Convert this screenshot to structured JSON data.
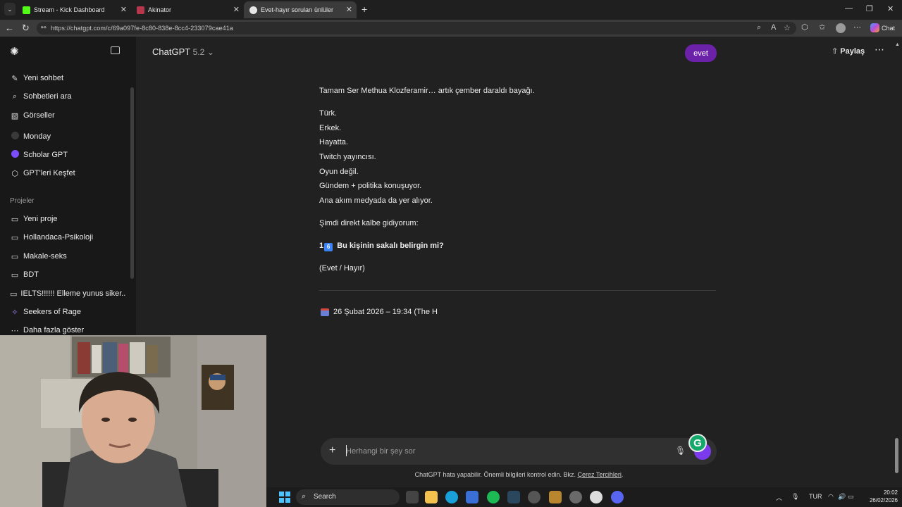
{
  "browser": {
    "tabs": [
      {
        "title": "Stream - Kick Dashboard",
        "active": false
      },
      {
        "title": "Akinator",
        "active": false
      },
      {
        "title": "Evet-hayır soruları ünlüler",
        "active": true
      }
    ],
    "url": "https://chatgpt.com/c/69a097fe-8c80-838e-8cc4-233079cae41a",
    "profile_label": "Chat"
  },
  "sidebar": {
    "top_items": [
      {
        "label": "Yeni sohbet",
        "icon": "edit-icon"
      },
      {
        "label": "Sohbetleri ara",
        "icon": "search-icon"
      },
      {
        "label": "Görseller",
        "icon": "image-icon"
      },
      {
        "label": "Monday",
        "icon": "monday-gpt-icon"
      },
      {
        "label": "Scholar GPT",
        "icon": "scholar-gpt-icon"
      },
      {
        "label": "GPT'leri Keşfet",
        "icon": "cube-icon"
      }
    ],
    "projects_label": "Projeler",
    "projects": [
      {
        "label": "Yeni proje",
        "icon": "new-folder-icon"
      },
      {
        "label": "Hollandaca-Psikoloji",
        "icon": "folder-icon"
      },
      {
        "label": "Makale-seks",
        "icon": "folder-icon"
      },
      {
        "label": "BDT",
        "icon": "folder-icon"
      },
      {
        "label": "IELTS!!!!!! Elleme yunus siker...",
        "icon": "folder-icon"
      },
      {
        "label": "Seekers of Rage",
        "icon": "sparkle-icon"
      },
      {
        "label": "Daha fazla göster",
        "icon": "ellipsis-icon"
      }
    ]
  },
  "header": {
    "model_name": "ChatGPT",
    "model_version": "5.2",
    "share_label": "Paylaş"
  },
  "conversation": {
    "user_bubble": "evet",
    "assistant_lines": [
      "Tamam Ser Methua Klozferamir… artık çember daraldı bayağı.",
      "Türk.",
      "Erkek.",
      "Hayatta.",
      "Twitch yayıncısı.",
      "Oyun değil.",
      "Gündem + politika konuşuyor.",
      "Ana akım medyada da yer alıyor.",
      "Şimdi direkt kalbe gidiyorum:"
    ],
    "question_prefix": "1",
    "question_badge": "6",
    "question_text": "Bu kişinin sakalı belirgin mi?",
    "options_text": "(Evet / Hayır)",
    "date_text": "26 Şubat 2026 – 19:34 (The H"
  },
  "composer": {
    "placeholder": "Herhangi bir şey sor",
    "grammarly_letter": "G"
  },
  "disclaimer": {
    "text": "ChatGPT hata yapabilir. Önemli bilgileri kontrol edin. Bkz.",
    "link": "Çerez Tercihleri",
    "end": "."
  },
  "taskbar": {
    "search_label": "Search",
    "language": "TUR",
    "time": "20:02",
    "date": "26/02/2026"
  },
  "colors": {
    "accent_purple": "#6b21a8",
    "background": "#212121",
    "sidebar_bg": "#181818"
  }
}
